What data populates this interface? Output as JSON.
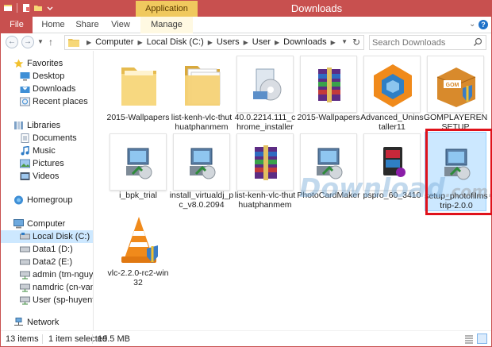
{
  "window": {
    "title": "Downloads",
    "contextual_tab": "Application Tools"
  },
  "ribbon": {
    "tabs": [
      {
        "label": "File"
      },
      {
        "label": "Home"
      },
      {
        "label": "Share"
      },
      {
        "label": "View"
      },
      {
        "label": "Manage"
      }
    ],
    "help": "?"
  },
  "address": {
    "crumbs": [
      "Computer",
      "Local Disk (C:)",
      "Users",
      "User",
      "Downloads"
    ]
  },
  "search": {
    "placeholder": "Search Downloads"
  },
  "nav": {
    "favorites": "Favorites",
    "favorites_items": [
      "Desktop",
      "Downloads",
      "Recent places"
    ],
    "libraries": "Libraries",
    "libraries_items": [
      "Documents",
      "Music",
      "Pictures",
      "Videos"
    ],
    "homegroup": "Homegroup",
    "computer": "Computer",
    "computer_items": [
      "Local Disk (C:)",
      "Data1 (D:)",
      "Data2 (E:)",
      "admin (tm-nguy",
      "namdric (cn-van",
      "User (sp-huyentr"
    ],
    "network": "Network"
  },
  "files": [
    {
      "name": "2015-Wallpapers",
      "icon": "folder-icon"
    },
    {
      "name": "list-kenh-vlc-thuthuatphanmem",
      "icon": "folder-stack-icon"
    },
    {
      "name": "40.0.2214.111_chrome_installer",
      "icon": "installer-disc-icon"
    },
    {
      "name": "2015-Wallpapers",
      "icon": "winrar-icon"
    },
    {
      "name": "Advanced_Uninstaller11",
      "icon": "uninstaller-icon"
    },
    {
      "name": "GOMPLAYERENSETUP",
      "icon": "gom-setup-icon"
    },
    {
      "name": "i_bpk_trial",
      "icon": "setup-icon"
    },
    {
      "name": "install_virtualdj_pc_v8.0.2094",
      "icon": "setup-icon"
    },
    {
      "name": "list-kenh-vlc-thuthuatphanmem",
      "icon": "winrar-icon"
    },
    {
      "name": "PhotoCardMaker",
      "icon": "setup-icon"
    },
    {
      "name": "pspro_60_3410",
      "icon": "pspro-icon"
    },
    {
      "name": "setup_photofilmstrip-2.0.0",
      "icon": "setup-icon"
    },
    {
      "name": "vlc-2.2.0-rc2-win32",
      "icon": "vlc-icon"
    }
  ],
  "watermark": {
    "main": "Download",
    "suffix": ".com.vn"
  },
  "status": {
    "count": "13 items",
    "selected": "1 item selected",
    "size": "19.5 MB"
  },
  "colors": {
    "accent": "#c8504f",
    "app_tools": "#f0c95e",
    "highlight": "#e0121b",
    "selection": "#cce8ff"
  }
}
